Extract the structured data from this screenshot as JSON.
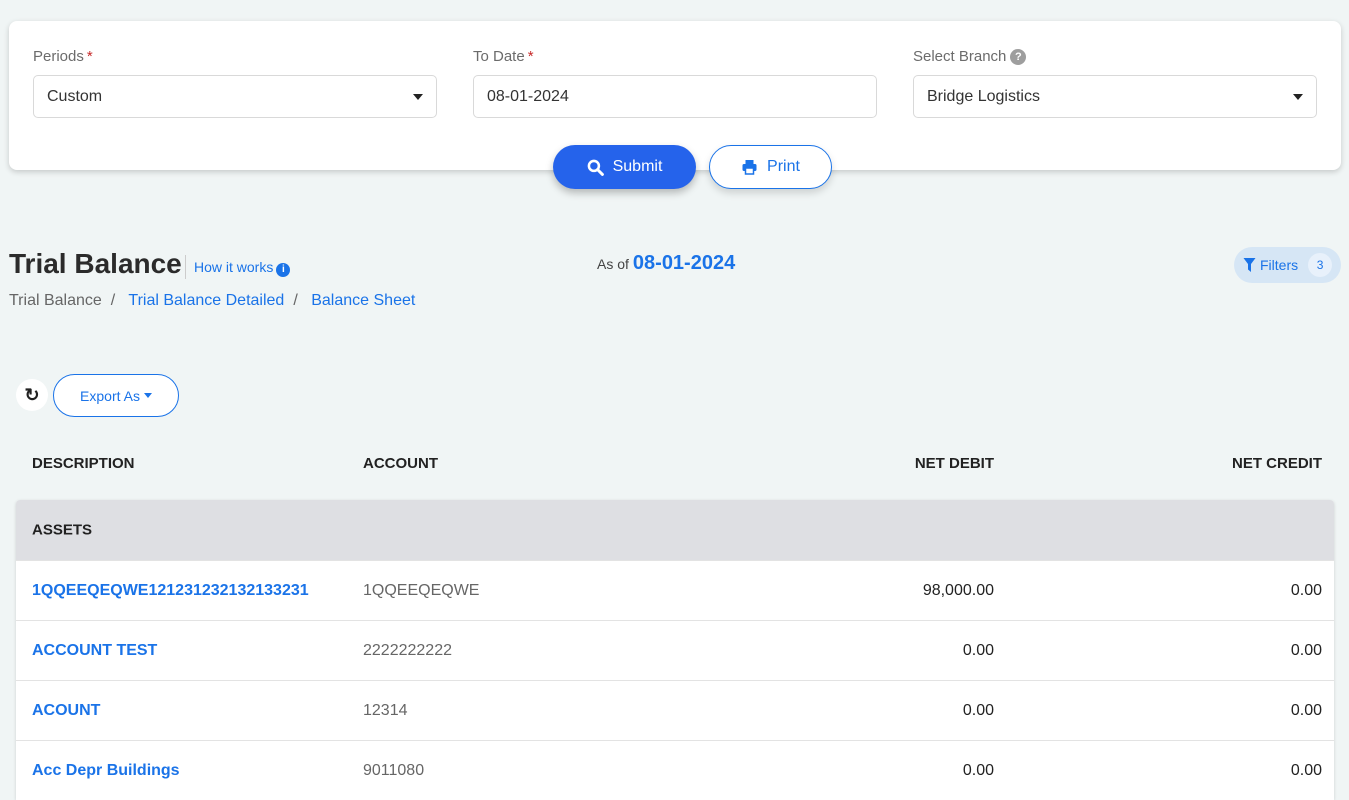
{
  "form": {
    "periods": {
      "label": "Periods",
      "required": "*",
      "value": "Custom"
    },
    "to_date": {
      "label": "To Date",
      "required": "*",
      "value": "08-01-2024"
    },
    "branch": {
      "label": "Select Branch",
      "help": "?",
      "value": "Bridge Logistics"
    },
    "submit_label": "Submit",
    "print_label": "Print"
  },
  "header": {
    "title": "Trial Balance",
    "how_it_works": "How it works",
    "as_of_label": "As of",
    "as_of_date": "08-01-2024",
    "filters_label": "Filters",
    "filters_count": "3"
  },
  "breadcrumb": [
    "Trial Balance",
    "Trial Balance Detailed",
    "Balance Sheet"
  ],
  "toolbar": {
    "export_label": "Export As"
  },
  "table": {
    "columns": [
      "DESCRIPTION",
      "ACCOUNT",
      "NET DEBIT",
      "NET CREDIT"
    ],
    "group": "ASSETS",
    "rows": [
      {
        "description": "1QQEEQEQWE12123123213213323 1",
        "account": "1QQEEQEQWE",
        "debit": "98,000.00",
        "credit": "0.00"
      },
      {
        "description": "ACCOUNT TEST",
        "account": "2222222222",
        "debit": "0.00",
        "credit": "0.00"
      },
      {
        "description": "ACOUNT",
        "account": "12314",
        "debit": "0.00",
        "credit": "0.00"
      },
      {
        "description": "Acc Depr Buildings",
        "account": "9011080",
        "debit": "0.00",
        "credit": "0.00"
      }
    ]
  },
  "colors": {
    "accent": "#1a73e8",
    "submit": "#2563eb",
    "background": "#f0f5f5"
  }
}
